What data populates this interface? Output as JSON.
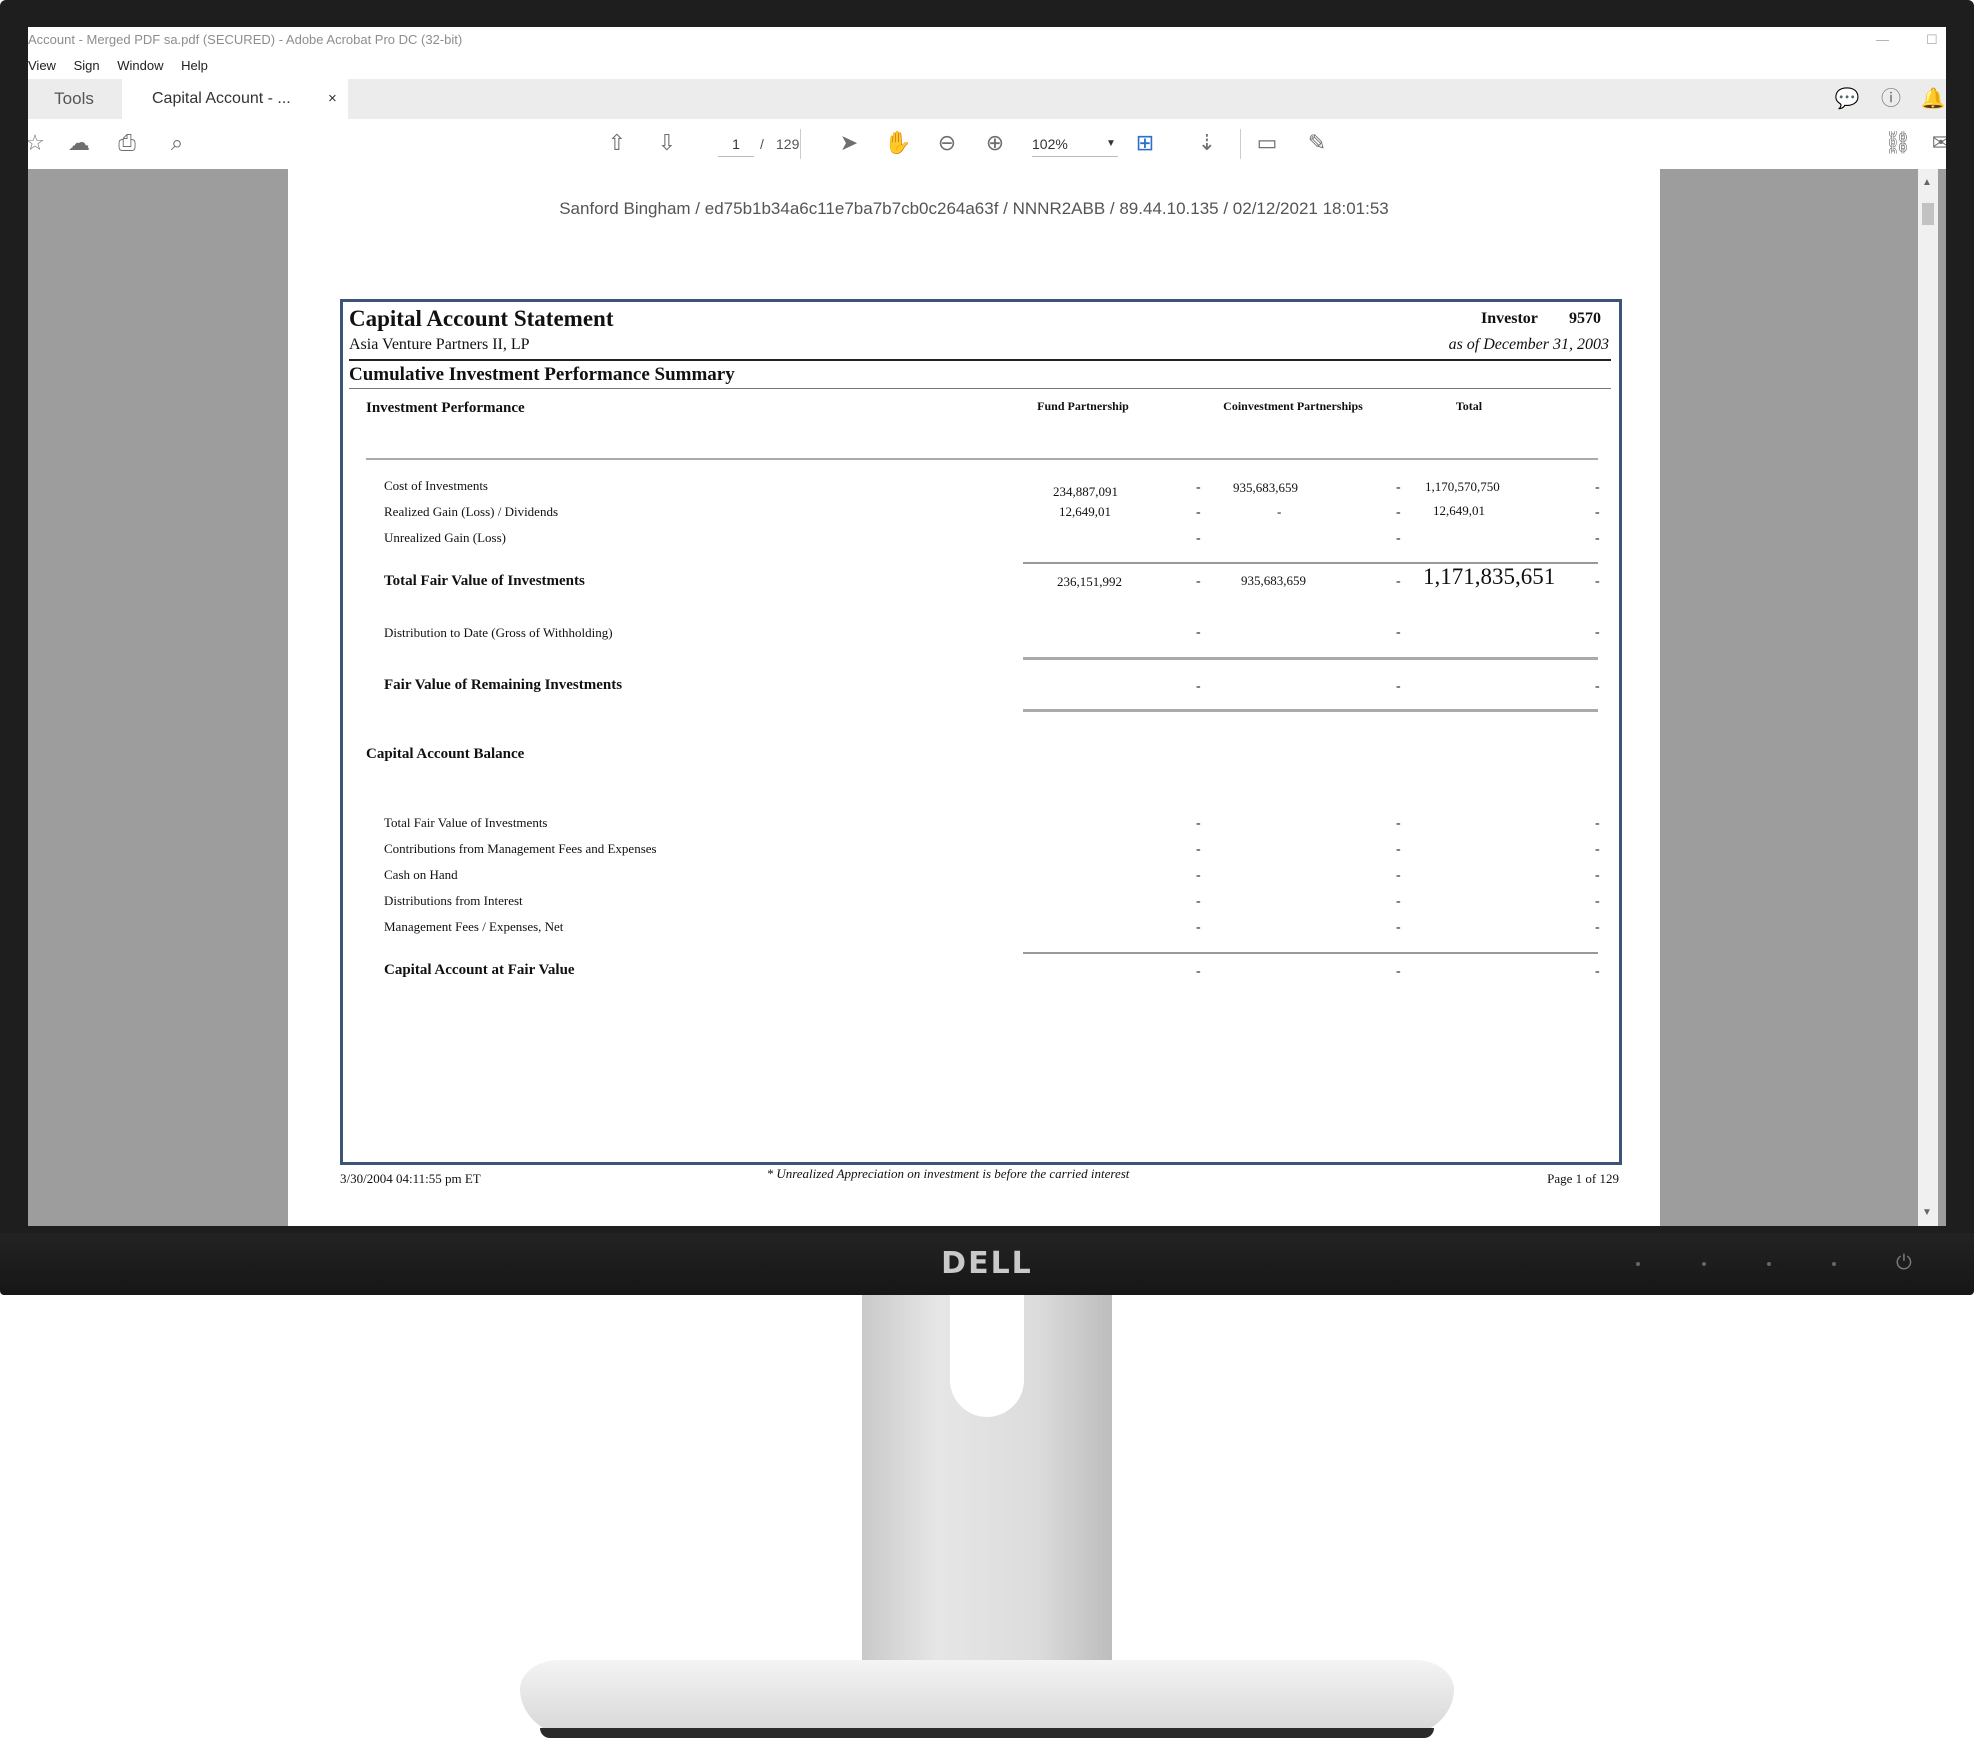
{
  "window": {
    "title": "Account - Merged PDF sa.pdf (SECURED) - Adobe Acrobat Pro DC (32-bit)"
  },
  "menu": [
    "View",
    "Sign",
    "Window",
    "Help"
  ],
  "tabs": {
    "tools": "Tools",
    "document": "Capital Account - ...",
    "close": "×"
  },
  "toolbar": {
    "page_current": "1",
    "page_separator": "/",
    "page_total": "129",
    "zoom": "102%"
  },
  "watermark": "Sanford Bingham / ed75b1b34a6c11e7ba7b7cb0c264a63f / NNNR2ABB / 89.44.10.135 / 02/12/2021 18:01:53",
  "statement": {
    "title": "Capital Account Statement",
    "fund": "Asia Venture Partners II, LP",
    "investor_label": "Investor",
    "investor_id": "9570",
    "as_of": "as of December 31, 2003",
    "summary_title": "Cumulative Investment Performance Summary",
    "section_performance": "Investment Performance",
    "col_fund": "Fund Partnership",
    "col_coinvest": "Coinvestment Partnerships",
    "col_total": "Total",
    "rows": {
      "cost_label": "Cost of Investments",
      "cost_fund": "234,887,091",
      "cost_coinvest": "935,683,659",
      "cost_total": "1,170,570,750",
      "realized_label": "Realized Gain (Loss) / Dividends",
      "realized_fund": "12,649,01",
      "realized_coinvest": "-",
      "realized_total": "12,649,01",
      "unrealized_label": "Unrealized Gain (Loss)",
      "tfv_label": "Total Fair Value of Investments",
      "tfv_fund": "236,151,992",
      "tfv_coinvest": "935,683,659",
      "tfv_total": "1,171,835,651",
      "dist_label": "Distribution to Date (Gross of Withholding)",
      "remaining_label": "Fair Value of Remaining Investments"
    },
    "section_balance": "Capital Account Balance",
    "balance_rows": {
      "b1": "Total Fair Value of Investments",
      "b2": "Contributions from Management Fees and Expenses",
      "b3": "Cash on Hand",
      "b4": "Distributions from Interest",
      "b5": "Management Fees / Expenses, Net"
    },
    "capital_fv_label": "Capital Account at Fair Value",
    "dash": "-",
    "footer_left": "3/30/2004  04:11:55 pm ET",
    "footer_center": "* Unrealized Appreciation on investment is before the carried interest",
    "footer_right": "Page 1 of 129"
  },
  "monitor": {
    "brand": "DELL"
  }
}
